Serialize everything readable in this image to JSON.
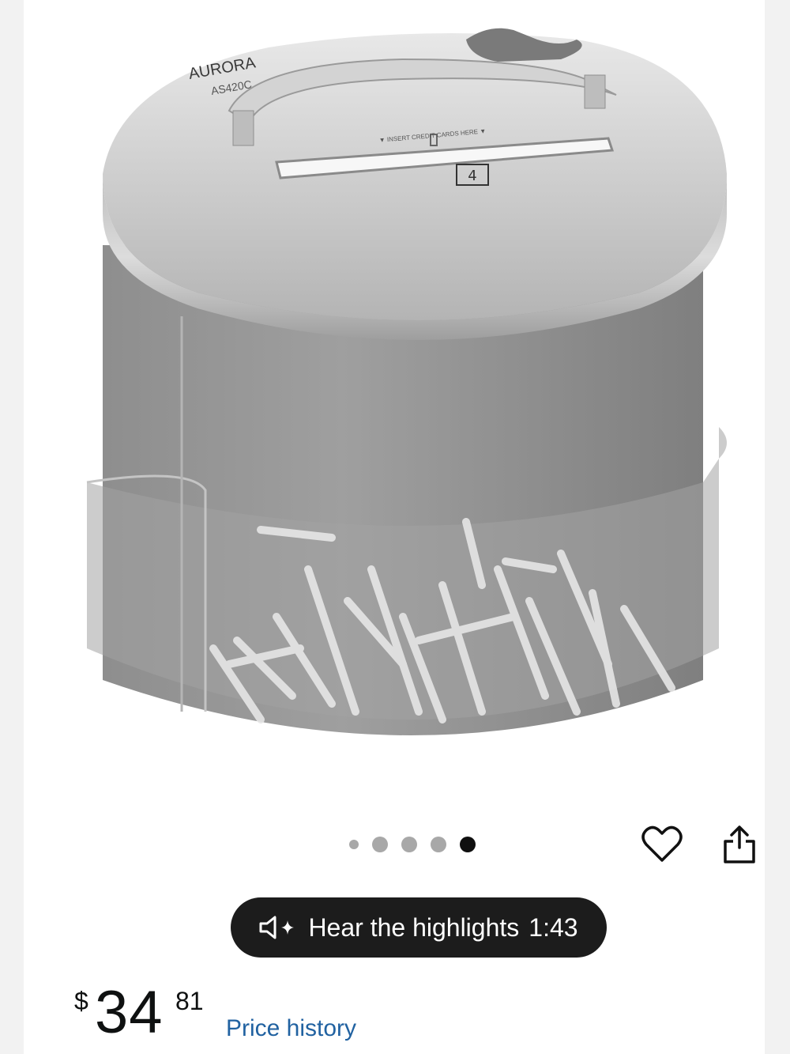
{
  "product": {
    "brand_label": "AURORA",
    "model_label": "AS420C",
    "slot_label": "▼ INSERT CREDIT CARDS HERE ▼",
    "security_level": "4"
  },
  "carousel": {
    "total": 5,
    "active_index": 4,
    "icons": {
      "favorite": "heart-icon",
      "share": "share-icon"
    }
  },
  "highlights": {
    "label": "Hear the highlights",
    "duration": "1:43",
    "icon": "speaker-sparkle-icon"
  },
  "price": {
    "currency_symbol": "$",
    "whole": "34",
    "fraction": "81"
  },
  "links": {
    "price_history": "Price history"
  },
  "colors": {
    "link": "#2162a1",
    "active_dot": "#0f0f0f",
    "inactive_dot": "#a8a8a8",
    "pill_bg": "#1c1c1c"
  }
}
